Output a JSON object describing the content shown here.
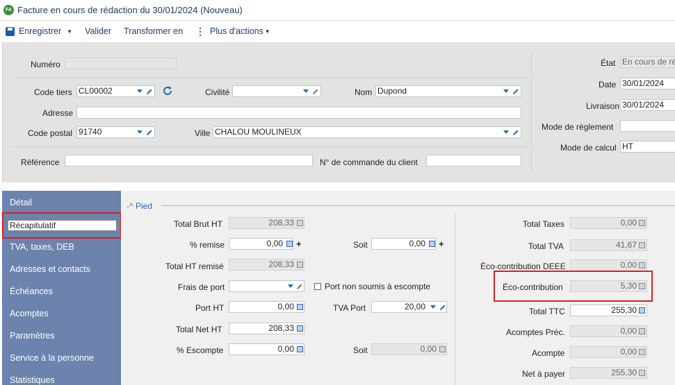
{
  "window": {
    "badge": "FA",
    "title": "Facture en cours de rédaction du 30/01/2024 (Nouveau)"
  },
  "toolbar": {
    "save": "Enregistrer",
    "validate": "Valider",
    "transform": "Transformer en",
    "more": "Plus d'actions"
  },
  "header": {
    "numero_label": "Numéro",
    "numero_value": "",
    "code_tiers_label": "Code tiers",
    "code_tiers_value": "CL00002",
    "civilite_label": "Civilité",
    "civilite_value": "",
    "nom_label": "Nom",
    "nom_value": "Dupond",
    "adresse_label": "Adresse",
    "adresse_value": "",
    "code_postal_label": "Code postal",
    "code_postal_value": "91740",
    "ville_label": "Ville",
    "ville_value": "CHALOU MOULINEUX",
    "reference_label": "Référence",
    "reference_value": "",
    "commande_label": "N° de commande du client",
    "commande_value": "",
    "etat_label": "État",
    "etat_value": "En cours de ré",
    "date_label": "Date",
    "date_value": "30/01/2024",
    "livraison_label": "Livraison",
    "livraison_value": "30/01/2024",
    "reglement_label": "Mode de règlement",
    "reglement_value": "",
    "calcul_label": "Mode de calcul",
    "calcul_value": "HT"
  },
  "sidebar": {
    "items": [
      "Détail",
      "Récapitulatif",
      "TVA, taxes, DEB",
      "Adresses et contacts",
      "Échéances",
      "Acomptes",
      "Paramètres",
      "Service à la personne",
      "Statistiques"
    ]
  },
  "pied": {
    "title": "Pied",
    "total_brut_label": "Total Brut HT",
    "total_brut_value": "208,33",
    "remise_label": "% remise",
    "remise_value": "0,00",
    "soit1_label": "Soit",
    "soit1_value": "0,00",
    "total_ht_remise_label": "Total HT remisé",
    "total_ht_remise_value": "208,33",
    "frais_port_label": "Frais de port",
    "frais_port_value": "",
    "port_escompte_label": "Port non soumis à escompte",
    "port_ht_label": "Port HT",
    "port_ht_value": "0,00",
    "tva_port_label": "TVA Port",
    "tva_port_value": "20,00",
    "total_net_label": "Total Net HT",
    "total_net_value": "208,33",
    "escompte_label": "% Escompte",
    "escompte_value": "0,00",
    "soit2_label": "Soit",
    "soit2_value": "0,00",
    "total_taxes_label": "Total Taxes",
    "total_taxes_value": "0,00",
    "total_tva_label": "Total TVA",
    "total_tva_value": "41,67",
    "eco_deee_label": "Éco-contribution DEEE",
    "eco_deee_value": "0,00",
    "eco_label": "Éco-contribution",
    "eco_value": "5,30",
    "total_ttc_label": "Total TTC",
    "total_ttc_value": "255,30",
    "acomptes_prec_label": "Acomptes Préc.",
    "acomptes_prec_value": "0,00",
    "acompte_label": "Acompte",
    "acompte_value": "0,00",
    "net_payer_label": "Net à payer",
    "net_payer_value": "255,30"
  },
  "colors": {
    "sidebar": "#6b83ad",
    "accent": "#2868b8",
    "highlight": "#d82020"
  }
}
